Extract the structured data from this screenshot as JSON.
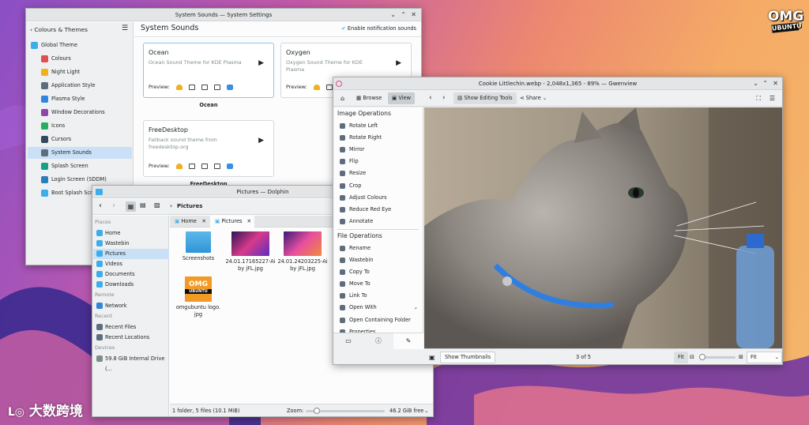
{
  "watermarks": {
    "omg_top": "OMG",
    "omg_bottom": "UBUNTU",
    "corner": "大数跨境"
  },
  "settings": {
    "title": "System Sounds — System Settings",
    "back_label": "Colours & Themes",
    "page_title": "System Sounds",
    "notify_label": "Enable notification sounds",
    "sidebar": [
      "Global Theme",
      "Colours",
      "Night Light",
      "Application Style",
      "Plasma Style",
      "Window Decorations",
      "Icons",
      "Cursors",
      "System Sounds",
      "Splash Screen",
      "Login Screen (SDDM)",
      "Boot Splash Screen"
    ],
    "sidebar_selected": "System Sounds",
    "cards": [
      {
        "name": "Ocean",
        "desc": "Ocean Sound Theme for KDE Plasma",
        "preview": "Preview:",
        "caption": "Ocean"
      },
      {
        "name": "Oxygen",
        "desc": "Oxygen Sound Theme for KDE Plasma",
        "preview": "Preview:",
        "caption": ""
      },
      {
        "name": "FreeDesktop",
        "desc": "Fallback sound theme from freedesktop.org",
        "preview": "Preview:",
        "caption": "FreeDesktop"
      }
    ],
    "colors": {
      "selection": "#c9e0f7",
      "card_selected_border": "#8fc3ee"
    }
  },
  "dolphin": {
    "title": "Pictures — Dolphin",
    "breadcrumb": "Pictures",
    "tabs": [
      "Home",
      "Pictures"
    ],
    "places_header": "Places",
    "places": [
      "Home",
      "Wastebin",
      "Pictures",
      "Videos",
      "Documents",
      "Downloads"
    ],
    "remote_header": "Remote",
    "remote": [
      "Network"
    ],
    "recent_header": "Recent",
    "recent": [
      "Recent Files",
      "Recent Locations"
    ],
    "devices_header": "Devices",
    "devices": [
      "59.8 GiB Internal Drive (..."
    ],
    "files": [
      {
        "name": "Screenshots",
        "line2": ""
      },
      {
        "name": "24.01.17165227-Ai",
        "line2": "by jFL.jpg"
      },
      {
        "name": "24.01.24203225-Ai",
        "line2": "by jFL.jpg"
      },
      {
        "name": "omgubuntu logo.",
        "line2": "jpg"
      }
    ],
    "logo_thumb": {
      "top": "OMG",
      "bottom": "UBUNTU"
    },
    "status": "1 folder, 5 files (10.1 MiB)",
    "zoom_label": "Zoom:",
    "free_space": "46.2 GiB free"
  },
  "gwenview": {
    "title": "Cookie Littlechin.webp - 2,048x1,365 - 89% — Gwenview",
    "toolbar": {
      "browse": "Browse",
      "view": "View",
      "edit": "Show Editing Tools",
      "share": "Share"
    },
    "image_ops_header": "Image Operations",
    "image_ops": [
      "Rotate Left",
      "Rotate Right",
      "Mirror",
      "Flip",
      "Resize",
      "Crop",
      "Adjust Colours",
      "Reduce Red Eye",
      "Annotate"
    ],
    "file_ops_header": "File Operations",
    "file_ops": [
      "Rename",
      "Wastebin",
      "Copy To",
      "Move To",
      "Link To",
      "Open With",
      "Open Containing Folder",
      "Properties"
    ],
    "thumbs_label": "Show Thumbnails",
    "page_indicator": "3 of 5",
    "fit_button": "Fit",
    "zoom_select": "Fit"
  },
  "common": {
    "min_icon": "minimize-icon",
    "max_icon": "maximize-icon",
    "close_icon": "close-icon"
  }
}
